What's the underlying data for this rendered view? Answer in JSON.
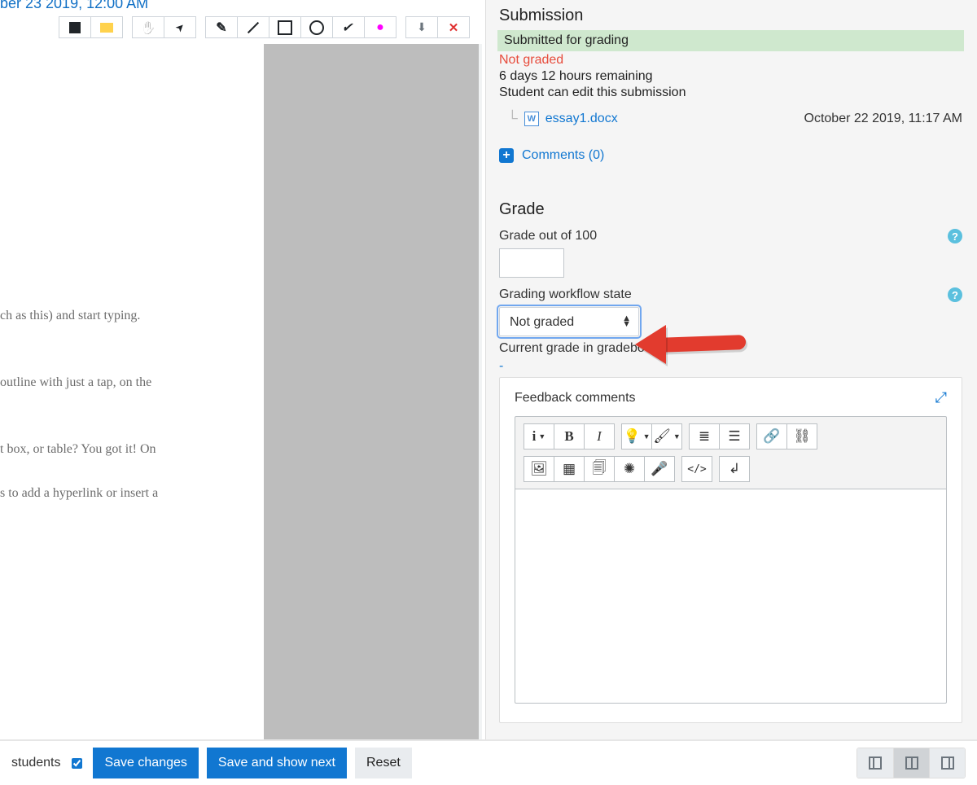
{
  "header": {
    "date_partial": "ber 23 2019, 12:00 AM"
  },
  "doc": {
    "p1": "ch as this) and start typing.",
    "p2": "outline with just a tap, on the",
    "p3": "t box, or table? You got it! On",
    "p4": "s to add a hyperlink or insert a"
  },
  "submission": {
    "heading": "Submission",
    "status_submitted": "Submitted for grading",
    "status_not_graded": "Not graded",
    "time_remaining": "6 days 12 hours remaining",
    "editable": "Student can edit this submission",
    "file_name": "essay1.docx",
    "file_date": "October 22 2019, 11:17 AM",
    "comments_label": "Comments (0)"
  },
  "grade": {
    "heading": "Grade",
    "out_of_label": "Grade out of 100",
    "grade_value": "",
    "workflow_label": "Grading workflow state",
    "workflow_value": "Not graded",
    "current_label": "Current grade in gradebook",
    "current_value": "-",
    "feedback_label": "Feedback comments"
  },
  "footer": {
    "notify_label": "students",
    "save": "Save changes",
    "save_next": "Save and show next",
    "reset": "Reset"
  }
}
